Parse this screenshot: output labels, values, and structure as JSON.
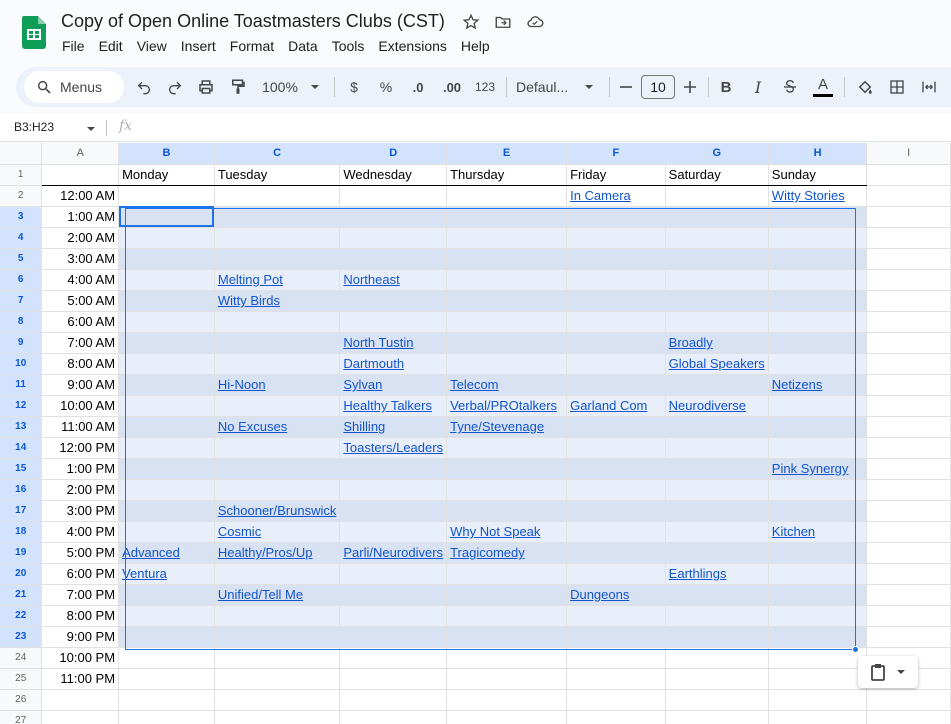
{
  "app": {
    "title": "Copy of Open Online Toastmasters Clubs (CST)",
    "brand_color": "#0f9d58"
  },
  "menu": [
    "File",
    "Edit",
    "View",
    "Insert",
    "Format",
    "Data",
    "Tools",
    "Extensions",
    "Help"
  ],
  "toolbar": {
    "search_label": "Menus",
    "zoom": "100%",
    "currency": "$",
    "percent": "%",
    "dec_decrease": ".0",
    "dec_increase": ".00",
    "number_format": "123",
    "font": "Defaul...",
    "font_size": "10",
    "bold": "B",
    "italic": "I",
    "text_color_glyph": "A"
  },
  "formula_bar": {
    "name_box": "B3:H23",
    "fx": "fx"
  },
  "sheet": {
    "columns": [
      "A",
      "B",
      "C",
      "D",
      "E",
      "F",
      "G",
      "H",
      "I"
    ],
    "selected_columns": [
      "B",
      "C",
      "D",
      "E",
      "F",
      "G",
      "H"
    ],
    "header_row": [
      "",
      "Monday",
      "Tuesday",
      "Wednesday",
      "Thursday",
      "Friday",
      "Saturday",
      "Sunday",
      ""
    ],
    "rows": [
      {
        "n": "2",
        "time": "12:00 AM",
        "cells": [
          "",
          "",
          "",
          "",
          "In Camera",
          "",
          "Witty Stories"
        ]
      },
      {
        "n": "3",
        "time": "1:00 AM",
        "cells": [
          "",
          "",
          "",
          "",
          "",
          "",
          ""
        ]
      },
      {
        "n": "4",
        "time": "2:00 AM",
        "cells": [
          "",
          "",
          "",
          "",
          "",
          "",
          ""
        ]
      },
      {
        "n": "5",
        "time": "3:00 AM",
        "cells": [
          "",
          "",
          "",
          "",
          "",
          "",
          ""
        ]
      },
      {
        "n": "6",
        "time": "4:00 AM",
        "cells": [
          "",
          "Melting Pot",
          "Northeast",
          "",
          "",
          "",
          ""
        ]
      },
      {
        "n": "7",
        "time": "5:00 AM",
        "cells": [
          "",
          "Witty Birds",
          "",
          "",
          "",
          "",
          ""
        ]
      },
      {
        "n": "8",
        "time": "6:00 AM",
        "cells": [
          "",
          "",
          "",
          "",
          "",
          "",
          ""
        ]
      },
      {
        "n": "9",
        "time": "7:00 AM",
        "cells": [
          "",
          "",
          "North Tustin",
          "",
          "",
          "Broadly",
          ""
        ]
      },
      {
        "n": "10",
        "time": "8:00 AM",
        "cells": [
          "",
          "",
          "Dartmouth",
          "",
          "",
          "Global Speakers",
          ""
        ]
      },
      {
        "n": "11",
        "time": "9:00 AM",
        "cells": [
          "",
          "Hi-Noon",
          "Sylvan",
          "Telecom",
          "",
          "",
          "Netizens"
        ]
      },
      {
        "n": "12",
        "time": "10:00 AM",
        "cells": [
          "",
          "",
          "Healthy Talkers",
          "Verbal/PROtalkers",
          "Garland Com",
          "Neurodiverse",
          ""
        ]
      },
      {
        "n": "13",
        "time": "11:00 AM",
        "cells": [
          "",
          "No Excuses",
          "Shilling",
          "Tyne/Stevenage",
          "",
          "",
          ""
        ]
      },
      {
        "n": "14",
        "time": "12:00 PM",
        "cells": [
          "",
          "",
          "Toasters/Leaders",
          "",
          "",
          "",
          ""
        ]
      },
      {
        "n": "15",
        "time": "1:00 PM",
        "cells": [
          "",
          "",
          "",
          "",
          "",
          "",
          "Pink Synergy"
        ]
      },
      {
        "n": "16",
        "time": "2:00 PM",
        "cells": [
          "",
          "",
          "",
          "",
          "",
          "",
          ""
        ]
      },
      {
        "n": "17",
        "time": "3:00 PM",
        "cells": [
          "",
          "Schooner/Brunswick",
          "",
          "",
          "",
          "",
          ""
        ]
      },
      {
        "n": "18",
        "time": "4:00 PM",
        "cells": [
          "",
          "Cosmic",
          "",
          "Why Not Speak",
          "",
          "",
          "Kitchen"
        ]
      },
      {
        "n": "19",
        "time": "5:00 PM",
        "cells": [
          "Advanced",
          "Healthy/Pros/Up",
          "Parli/Neurodivers",
          "Tragicomedy",
          "",
          "",
          ""
        ]
      },
      {
        "n": "20",
        "time": "6:00 PM",
        "cells": [
          "Ventura",
          "",
          "",
          "",
          "",
          "Earthlings",
          ""
        ]
      },
      {
        "n": "21",
        "time": "7:00 PM",
        "cells": [
          "",
          "Unified/Tell Me",
          "",
          "",
          "Dungeons",
          "",
          ""
        ]
      },
      {
        "n": "22",
        "time": "8:00 PM",
        "cells": [
          "",
          "",
          "",
          "",
          "",
          "",
          ""
        ]
      },
      {
        "n": "23",
        "time": "9:00 PM",
        "cells": [
          "",
          "",
          "",
          "",
          "",
          "",
          ""
        ]
      },
      {
        "n": "24",
        "time": "10:00 PM",
        "cells": [
          "",
          "",
          "",
          "",
          "",
          "",
          ""
        ]
      },
      {
        "n": "25",
        "time": "11:00 PM",
        "cells": [
          "",
          "",
          "",
          "",
          "",
          "",
          ""
        ]
      },
      {
        "n": "26",
        "time": "",
        "cells": [
          "",
          "",
          "",
          "",
          "",
          "",
          ""
        ]
      },
      {
        "n": "27",
        "time": "",
        "cells": [
          "",
          "",
          "",
          "",
          "",
          "",
          ""
        ]
      }
    ]
  }
}
